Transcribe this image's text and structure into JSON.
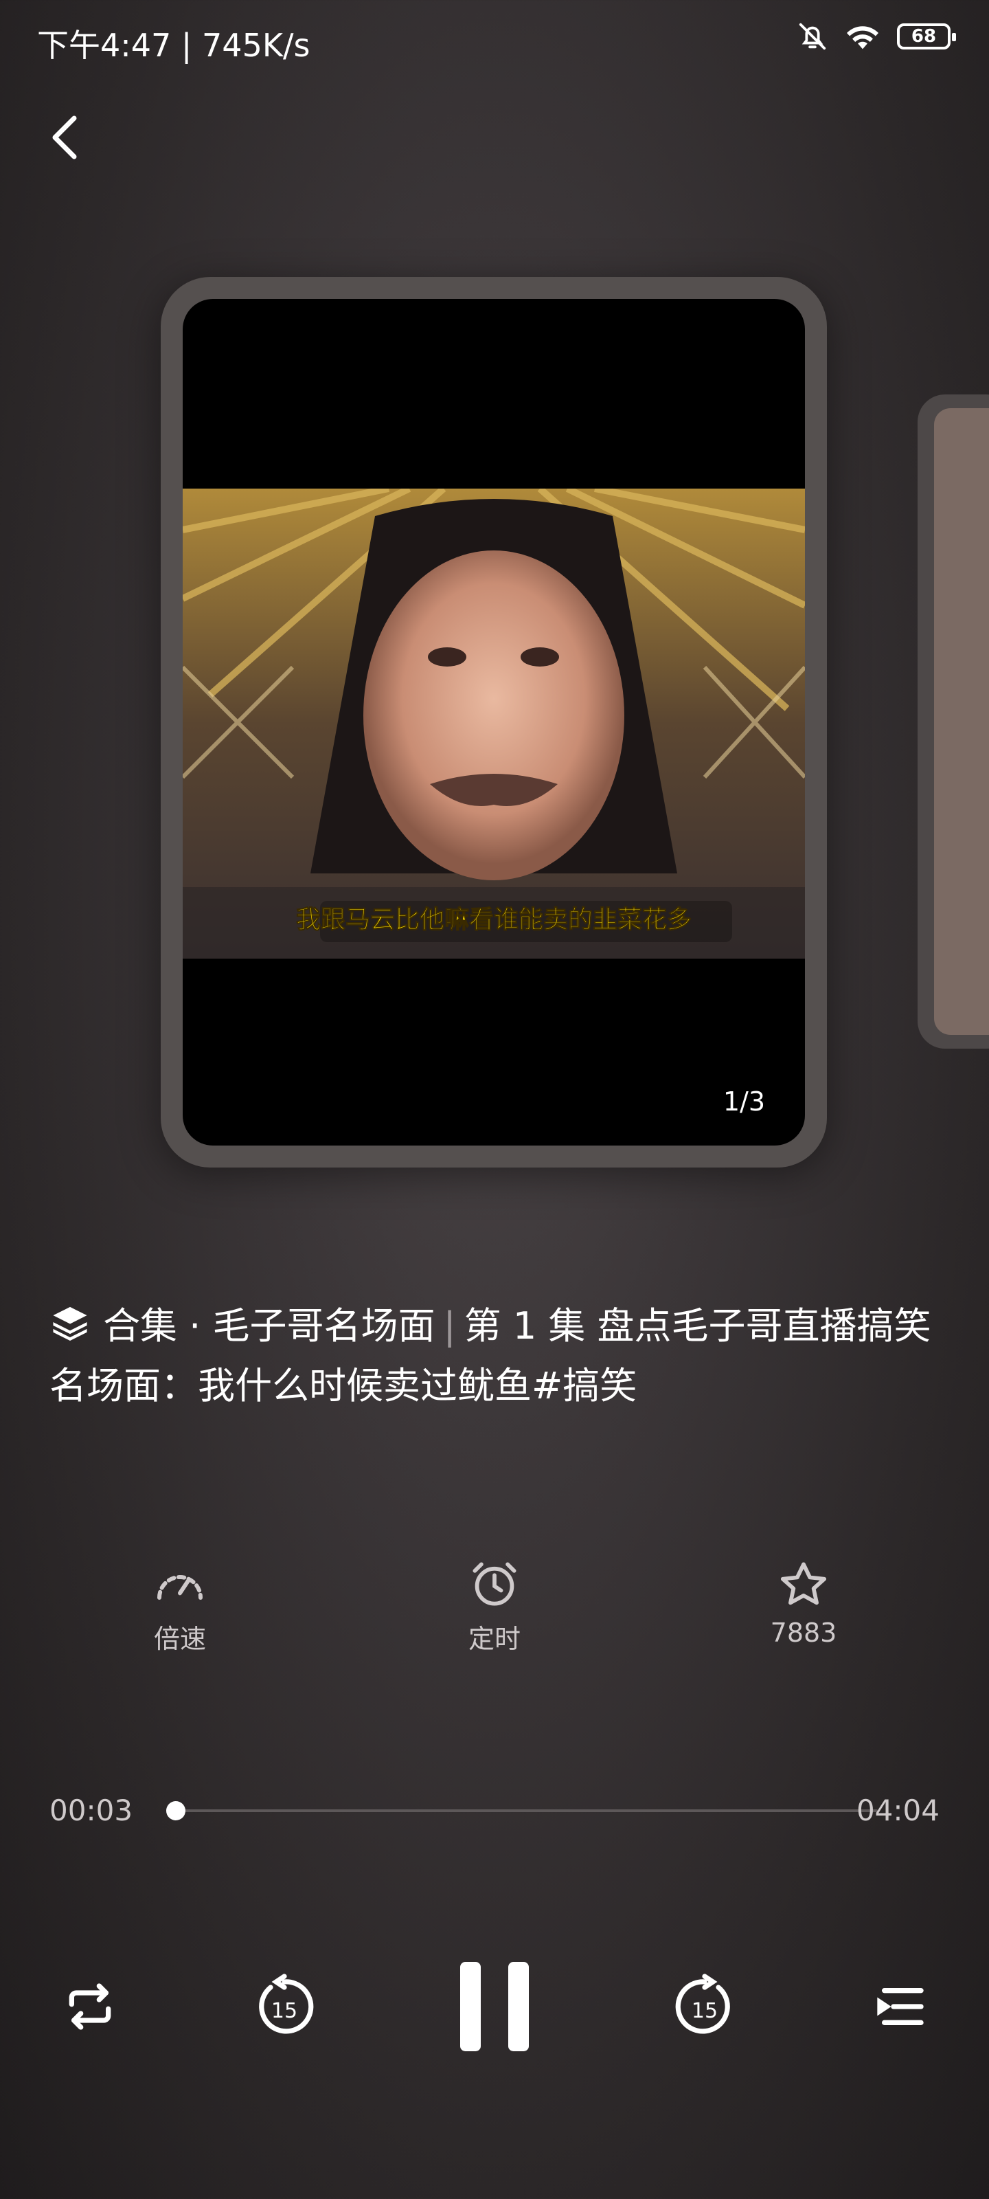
{
  "status": {
    "time_speed": "下午4:47 | 745K/s",
    "battery": "68"
  },
  "video": {
    "subtitle": "我跟马云比他嘛看谁能卖的韭菜花多",
    "page_indicator": "1/3"
  },
  "title": {
    "collection": "合集 · 毛子哥名场面",
    "separator": "|",
    "episode_text": "第 1 集 盘点毛子哥直播搞笑名场面：我什么时候卖过鱿鱼#搞笑"
  },
  "actions": [
    {
      "label": "倍速",
      "icon": "speed-gauge-icon"
    },
    {
      "label": "定时",
      "icon": "alarm-clock-icon"
    },
    {
      "label": "7883",
      "icon": "star-icon"
    }
  ],
  "progress": {
    "current": "00:03",
    "total": "04:04",
    "fraction": 0.012
  },
  "controls": {
    "rewind_label": "15",
    "forward_label": "15"
  },
  "colors": {
    "accent": "#ffffff",
    "muted": "#cfcacb",
    "background": "#2b2728"
  }
}
